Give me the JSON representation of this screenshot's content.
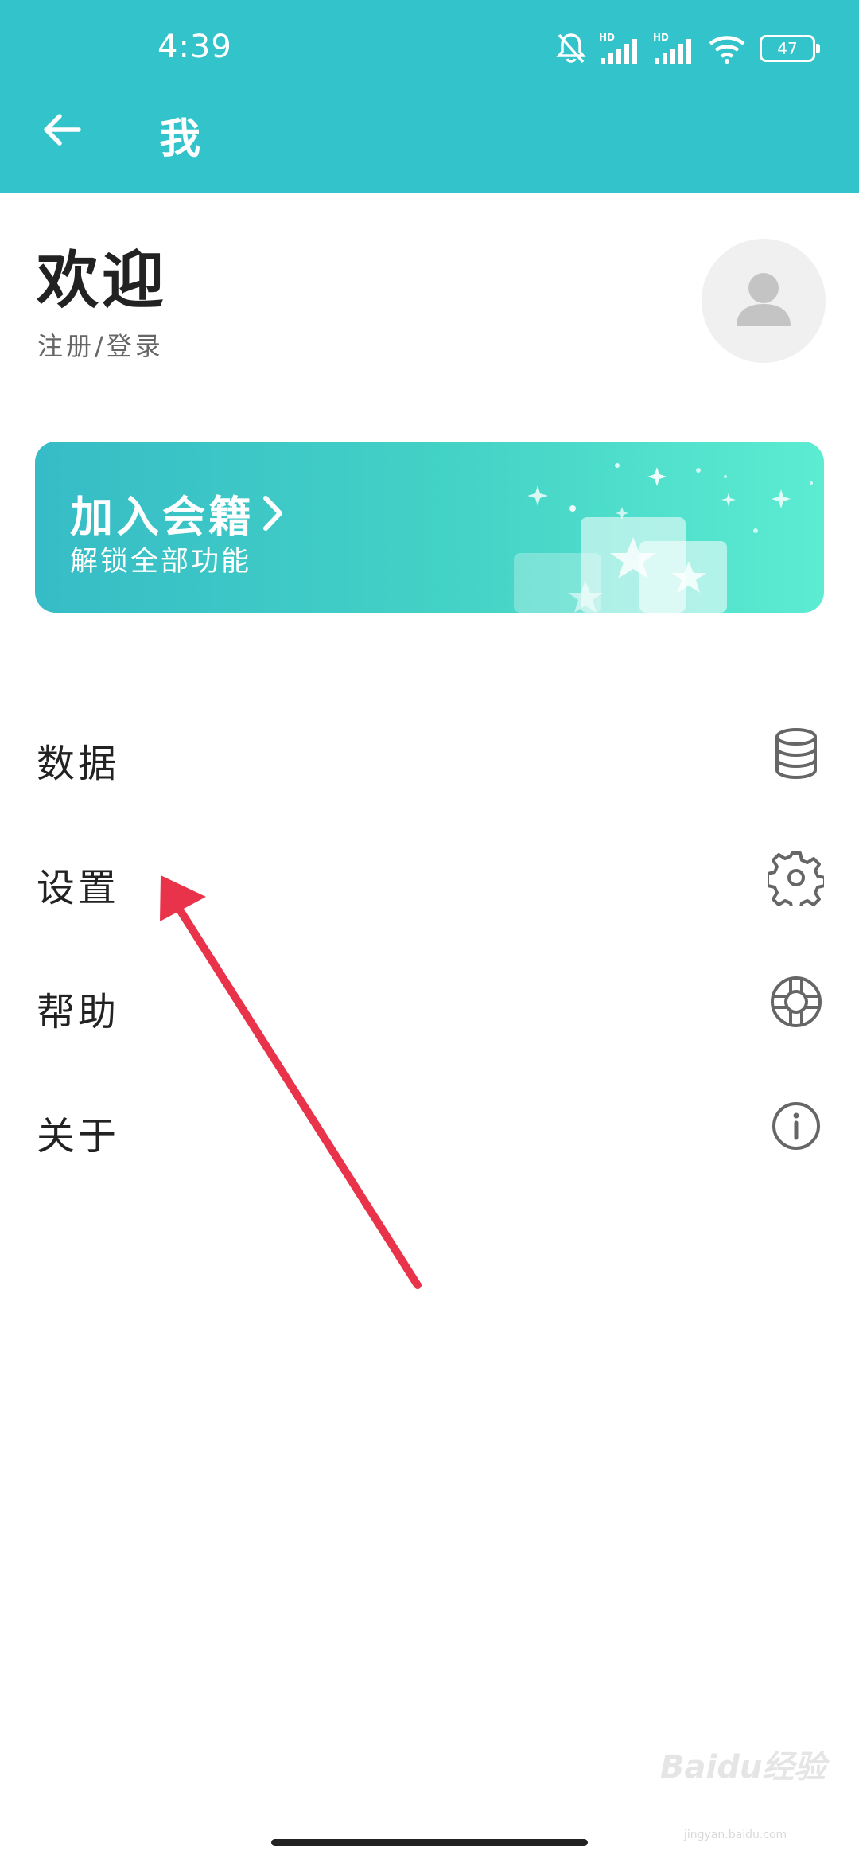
{
  "status_bar": {
    "time": "4:39",
    "battery": "47"
  },
  "header": {
    "title": "我"
  },
  "profile": {
    "welcome": "欢迎",
    "login_link": "注册/登录"
  },
  "membership": {
    "title": "加入会籍",
    "subtitle": "解锁全部功能"
  },
  "menu": {
    "items": [
      {
        "label": "数据",
        "icon": "database-icon"
      },
      {
        "label": "设置",
        "icon": "gear-icon"
      },
      {
        "label": "帮助",
        "icon": "lifebuoy-icon"
      },
      {
        "label": "关于",
        "icon": "info-icon"
      }
    ]
  },
  "colors": {
    "header_bg": "#32c3cb",
    "annotation_arrow": "#e8334a"
  },
  "watermark": {
    "logo": "Baidu经验",
    "url": "jingyan.baidu.com"
  }
}
